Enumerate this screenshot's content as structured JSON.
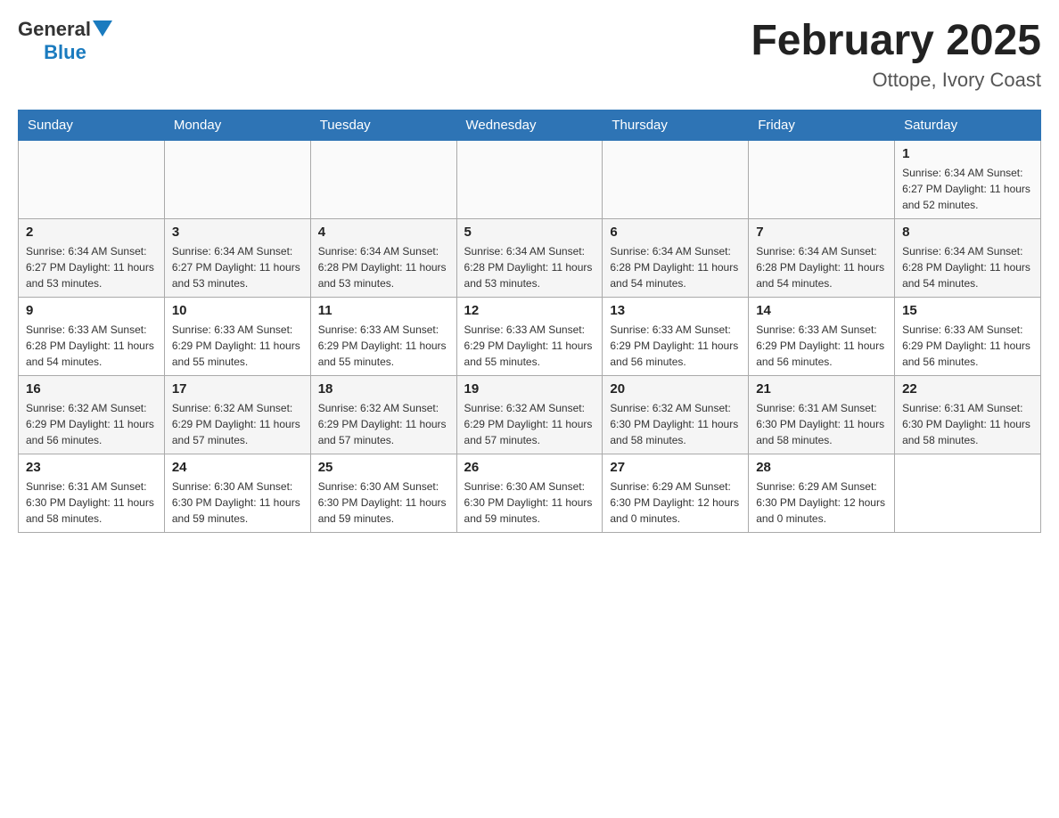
{
  "header": {
    "logo": {
      "general": "General",
      "blue": "Blue",
      "arrow_unicode": "▼"
    },
    "title": "February 2025",
    "location": "Ottope, Ivory Coast"
  },
  "weekdays": [
    "Sunday",
    "Monday",
    "Tuesday",
    "Wednesday",
    "Thursday",
    "Friday",
    "Saturday"
  ],
  "weeks": [
    {
      "days": [
        {
          "number": "",
          "info": ""
        },
        {
          "number": "",
          "info": ""
        },
        {
          "number": "",
          "info": ""
        },
        {
          "number": "",
          "info": ""
        },
        {
          "number": "",
          "info": ""
        },
        {
          "number": "",
          "info": ""
        },
        {
          "number": "1",
          "info": "Sunrise: 6:34 AM\nSunset: 6:27 PM\nDaylight: 11 hours\nand 52 minutes."
        }
      ]
    },
    {
      "days": [
        {
          "number": "2",
          "info": "Sunrise: 6:34 AM\nSunset: 6:27 PM\nDaylight: 11 hours\nand 53 minutes."
        },
        {
          "number": "3",
          "info": "Sunrise: 6:34 AM\nSunset: 6:27 PM\nDaylight: 11 hours\nand 53 minutes."
        },
        {
          "number": "4",
          "info": "Sunrise: 6:34 AM\nSunset: 6:28 PM\nDaylight: 11 hours\nand 53 minutes."
        },
        {
          "number": "5",
          "info": "Sunrise: 6:34 AM\nSunset: 6:28 PM\nDaylight: 11 hours\nand 53 minutes."
        },
        {
          "number": "6",
          "info": "Sunrise: 6:34 AM\nSunset: 6:28 PM\nDaylight: 11 hours\nand 54 minutes."
        },
        {
          "number": "7",
          "info": "Sunrise: 6:34 AM\nSunset: 6:28 PM\nDaylight: 11 hours\nand 54 minutes."
        },
        {
          "number": "8",
          "info": "Sunrise: 6:34 AM\nSunset: 6:28 PM\nDaylight: 11 hours\nand 54 minutes."
        }
      ]
    },
    {
      "days": [
        {
          "number": "9",
          "info": "Sunrise: 6:33 AM\nSunset: 6:28 PM\nDaylight: 11 hours\nand 54 minutes."
        },
        {
          "number": "10",
          "info": "Sunrise: 6:33 AM\nSunset: 6:29 PM\nDaylight: 11 hours\nand 55 minutes."
        },
        {
          "number": "11",
          "info": "Sunrise: 6:33 AM\nSunset: 6:29 PM\nDaylight: 11 hours\nand 55 minutes."
        },
        {
          "number": "12",
          "info": "Sunrise: 6:33 AM\nSunset: 6:29 PM\nDaylight: 11 hours\nand 55 minutes."
        },
        {
          "number": "13",
          "info": "Sunrise: 6:33 AM\nSunset: 6:29 PM\nDaylight: 11 hours\nand 56 minutes."
        },
        {
          "number": "14",
          "info": "Sunrise: 6:33 AM\nSunset: 6:29 PM\nDaylight: 11 hours\nand 56 minutes."
        },
        {
          "number": "15",
          "info": "Sunrise: 6:33 AM\nSunset: 6:29 PM\nDaylight: 11 hours\nand 56 minutes."
        }
      ]
    },
    {
      "days": [
        {
          "number": "16",
          "info": "Sunrise: 6:32 AM\nSunset: 6:29 PM\nDaylight: 11 hours\nand 56 minutes."
        },
        {
          "number": "17",
          "info": "Sunrise: 6:32 AM\nSunset: 6:29 PM\nDaylight: 11 hours\nand 57 minutes."
        },
        {
          "number": "18",
          "info": "Sunrise: 6:32 AM\nSunset: 6:29 PM\nDaylight: 11 hours\nand 57 minutes."
        },
        {
          "number": "19",
          "info": "Sunrise: 6:32 AM\nSunset: 6:29 PM\nDaylight: 11 hours\nand 57 minutes."
        },
        {
          "number": "20",
          "info": "Sunrise: 6:32 AM\nSunset: 6:30 PM\nDaylight: 11 hours\nand 58 minutes."
        },
        {
          "number": "21",
          "info": "Sunrise: 6:31 AM\nSunset: 6:30 PM\nDaylight: 11 hours\nand 58 minutes."
        },
        {
          "number": "22",
          "info": "Sunrise: 6:31 AM\nSunset: 6:30 PM\nDaylight: 11 hours\nand 58 minutes."
        }
      ]
    },
    {
      "days": [
        {
          "number": "23",
          "info": "Sunrise: 6:31 AM\nSunset: 6:30 PM\nDaylight: 11 hours\nand 58 minutes."
        },
        {
          "number": "24",
          "info": "Sunrise: 6:30 AM\nSunset: 6:30 PM\nDaylight: 11 hours\nand 59 minutes."
        },
        {
          "number": "25",
          "info": "Sunrise: 6:30 AM\nSunset: 6:30 PM\nDaylight: 11 hours\nand 59 minutes."
        },
        {
          "number": "26",
          "info": "Sunrise: 6:30 AM\nSunset: 6:30 PM\nDaylight: 11 hours\nand 59 minutes."
        },
        {
          "number": "27",
          "info": "Sunrise: 6:29 AM\nSunset: 6:30 PM\nDaylight: 12 hours\nand 0 minutes."
        },
        {
          "number": "28",
          "info": "Sunrise: 6:29 AM\nSunset: 6:30 PM\nDaylight: 12 hours\nand 0 minutes."
        },
        {
          "number": "",
          "info": ""
        }
      ]
    }
  ]
}
